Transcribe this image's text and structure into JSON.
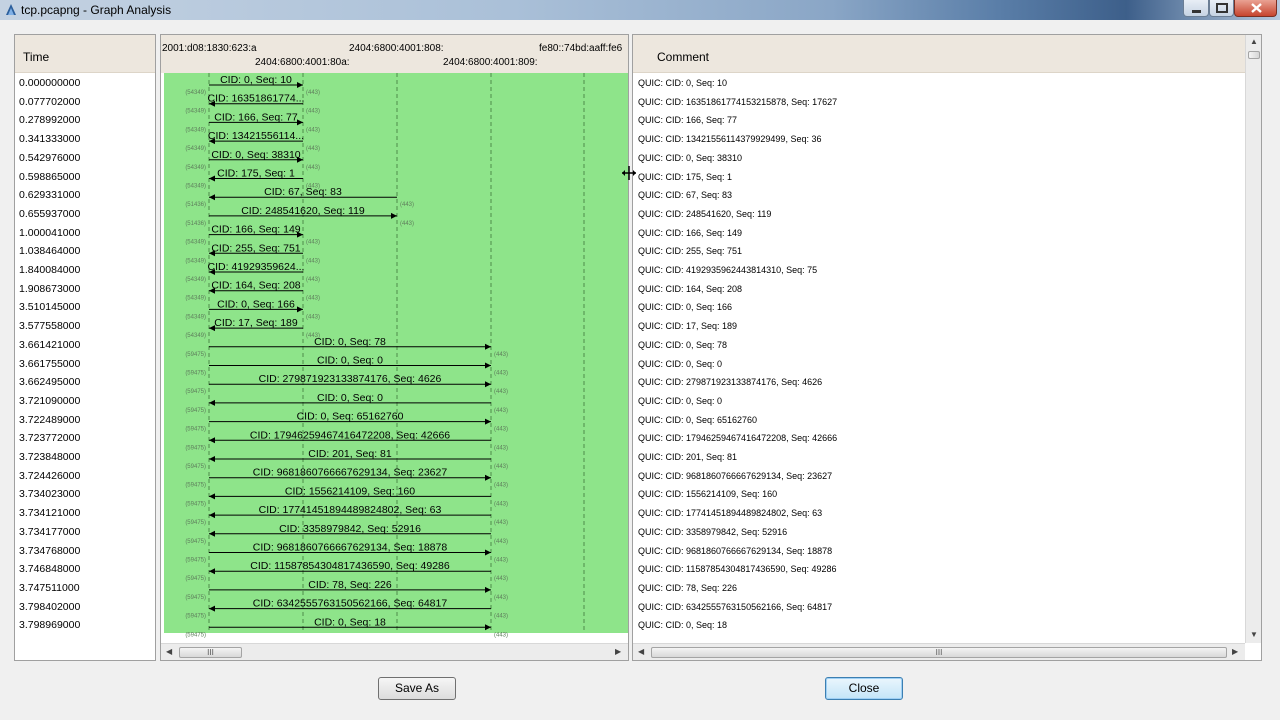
{
  "window": {
    "title": "tcp.pcapng - Graph Analysis"
  },
  "time_header": "Time",
  "comment_header": "Comment",
  "hosts_top": [
    "2001:d08:1830:623:a",
    "2404:6800:4001:808:",
    "fe80::74bd:aaff:fe6"
  ],
  "hosts_bottom": [
    "2404:6800:4001:80a:",
    "2404:6800:4001:809:"
  ],
  "rows": [
    {
      "time": "0.000000000",
      "label": "CID: 0, Seq: 10",
      "comment": "QUIC: CID: 0, Seq: 10",
      "from": 0,
      "to": 1,
      "sport": "(54349)",
      "dport": "(443)"
    },
    {
      "time": "0.077702000",
      "label": "CID: 16351861774...",
      "comment": "QUIC: CID: 16351861774153215878, Seq: 17627",
      "from": 1,
      "to": 0,
      "sport": "(54349)",
      "dport": "(443)"
    },
    {
      "time": "0.278992000",
      "label": "CID: 166, Seq: 77",
      "comment": "QUIC: CID: 166, Seq: 77",
      "from": 0,
      "to": 1,
      "sport": "(54349)",
      "dport": "(443)"
    },
    {
      "time": "0.341333000",
      "label": "CID: 13421556114...",
      "comment": "QUIC: CID: 13421556114379929499, Seq: 36",
      "from": 1,
      "to": 0,
      "sport": "(54349)",
      "dport": "(443)"
    },
    {
      "time": "0.542976000",
      "label": "CID: 0, Seq: 38310",
      "comment": "QUIC: CID: 0, Seq: 38310",
      "from": 0,
      "to": 1,
      "sport": "(54349)",
      "dport": "(443)"
    },
    {
      "time": "0.598865000",
      "label": "CID: 175, Seq: 1",
      "comment": "QUIC: CID: 175, Seq: 1",
      "from": 1,
      "to": 0,
      "sport": "(54349)",
      "dport": "(443)"
    },
    {
      "time": "0.629331000",
      "label": "CID: 67, Seq: 83",
      "comment": "QUIC: CID: 67, Seq: 83",
      "from": 2,
      "to": 0,
      "sport": "(51436)",
      "dport": "(443)"
    },
    {
      "time": "0.655937000",
      "label": "CID: 248541620, Seq: 119",
      "comment": "QUIC: CID: 248541620, Seq: 119",
      "from": 0,
      "to": 2,
      "sport": "(51436)",
      "dport": "(443)"
    },
    {
      "time": "1.000041000",
      "label": "CID: 166, Seq: 149",
      "comment": "QUIC: CID: 166, Seq: 149",
      "from": 0,
      "to": 1,
      "sport": "(54349)",
      "dport": "(443)"
    },
    {
      "time": "1.038464000",
      "label": "CID: 255, Seq: 751",
      "comment": "QUIC: CID: 255, Seq: 751",
      "from": 1,
      "to": 0,
      "sport": "(54349)",
      "dport": "(443)"
    },
    {
      "time": "1.840084000",
      "label": "CID: 41929359624...",
      "comment": "QUIC: CID: 4192935962443814310, Seq: 75",
      "from": 1,
      "to": 0,
      "sport": "(54349)",
      "dport": "(443)"
    },
    {
      "time": "1.908673000",
      "label": "CID: 164, Seq: 208",
      "comment": "QUIC: CID: 164, Seq: 208",
      "from": 1,
      "to": 0,
      "sport": "(54349)",
      "dport": "(443)"
    },
    {
      "time": "3.510145000",
      "label": "CID: 0, Seq: 166",
      "comment": "QUIC: CID: 0, Seq: 166",
      "from": 0,
      "to": 1,
      "sport": "(54349)",
      "dport": "(443)"
    },
    {
      "time": "3.577558000",
      "label": "CID: 17, Seq: 189",
      "comment": "QUIC: CID: 17, Seq: 189",
      "from": 1,
      "to": 0,
      "sport": "(54349)",
      "dport": "(443)"
    },
    {
      "time": "3.661421000",
      "label": "CID: 0, Seq: 78",
      "comment": "QUIC: CID: 0, Seq: 78",
      "from": 0,
      "to": 3,
      "sport": "(59475)",
      "dport": "(443)"
    },
    {
      "time": "3.661755000",
      "label": "CID: 0, Seq: 0",
      "comment": "QUIC: CID: 0, Seq: 0",
      "from": 0,
      "to": 3,
      "sport": "(59475)",
      "dport": "(443)"
    },
    {
      "time": "3.662495000",
      "label": "CID: 279871923133874176, Seq: 4626",
      "comment": "QUIC: CID: 279871923133874176, Seq: 4626",
      "from": 0,
      "to": 3,
      "sport": "(59475)",
      "dport": "(443)"
    },
    {
      "time": "3.721090000",
      "label": "CID: 0, Seq: 0",
      "comment": "QUIC: CID: 0, Seq: 0",
      "from": 3,
      "to": 0,
      "sport": "(59475)",
      "dport": "(443)"
    },
    {
      "time": "3.722489000",
      "label": "CID: 0, Seq: 65162760",
      "comment": "QUIC: CID: 0, Seq: 65162760",
      "from": 0,
      "to": 3,
      "sport": "(59475)",
      "dport": "(443)"
    },
    {
      "time": "3.723772000",
      "label": "CID: 17946259467416472208, Seq: 42666",
      "comment": "QUIC: CID: 17946259467416472208, Seq: 42666",
      "from": 3,
      "to": 0,
      "sport": "(59475)",
      "dport": "(443)"
    },
    {
      "time": "3.723848000",
      "label": "CID: 201, Seq: 81",
      "comment": "QUIC: CID: 201, Seq: 81",
      "from": 3,
      "to": 0,
      "sport": "(59475)",
      "dport": "(443)"
    },
    {
      "time": "3.724426000",
      "label": "CID: 9681860766667629134, Seq: 23627",
      "comment": "QUIC: CID: 9681860766667629134, Seq: 23627",
      "from": 0,
      "to": 3,
      "sport": "(59475)",
      "dport": "(443)"
    },
    {
      "time": "3.734023000",
      "label": "CID: 1556214109, Seq: 160",
      "comment": "QUIC: CID: 1556214109, Seq: 160",
      "from": 3,
      "to": 0,
      "sport": "(59475)",
      "dport": "(443)"
    },
    {
      "time": "3.734121000",
      "label": "CID: 17741451894489824802, Seq: 63",
      "comment": "QUIC: CID: 17741451894489824802, Seq: 63",
      "from": 3,
      "to": 0,
      "sport": "(59475)",
      "dport": "(443)"
    },
    {
      "time": "3.734177000",
      "label": "CID: 3358979842, Seq: 52916",
      "comment": "QUIC: CID: 3358979842, Seq: 52916",
      "from": 3,
      "to": 0,
      "sport": "(59475)",
      "dport": "(443)"
    },
    {
      "time": "3.734768000",
      "label": "CID: 9681860766667629134, Seq: 18878",
      "comment": "QUIC: CID: 9681860766667629134, Seq: 18878",
      "from": 0,
      "to": 3,
      "sport": "(59475)",
      "dport": "(443)"
    },
    {
      "time": "3.746848000",
      "label": "CID: 11587854304817436590, Seq: 49286",
      "comment": "QUIC: CID: 11587854304817436590, Seq: 49286",
      "from": 3,
      "to": 0,
      "sport": "(59475)",
      "dport": "(443)"
    },
    {
      "time": "3.747511000",
      "label": "CID: 78, Seq: 226",
      "comment": "QUIC: CID: 78, Seq: 226",
      "from": 0,
      "to": 3,
      "sport": "(59475)",
      "dport": "(443)"
    },
    {
      "time": "3.798402000",
      "label": "CID: 6342555763150562166, Seq: 64817",
      "comment": "QUIC: CID: 6342555763150562166, Seq: 64817",
      "from": 3,
      "to": 0,
      "sport": "(59475)",
      "dport": "(443)"
    },
    {
      "time": "3.798969000",
      "label": "CID: 0, Seq: 18",
      "comment": "QUIC: CID: 0, Seq: 18",
      "from": 0,
      "to": 3,
      "sport": "(59475)",
      "dport": "(443)"
    }
  ],
  "buttons": {
    "save_as": "Save As",
    "close": "Close"
  },
  "colors": {
    "graph_bg": "#8ee48a",
    "header_bg": "#ede7de"
  },
  "icons": {
    "window": "wireshark-fin-icon",
    "scroll_grip": "grip-icon"
  }
}
